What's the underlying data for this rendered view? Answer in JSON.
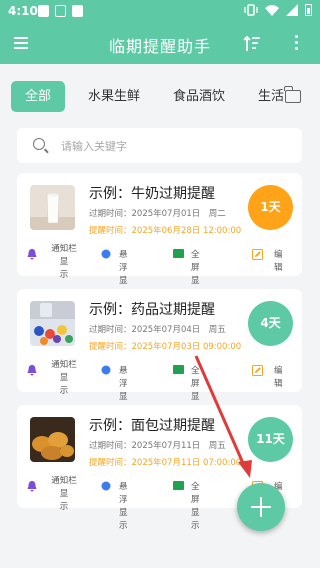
{
  "status": {
    "time": "4:10"
  },
  "appbar": {
    "title": "临期提醒助手"
  },
  "tabs": [
    "全部",
    "水果生鲜",
    "食品酒饮",
    "生活"
  ],
  "search": {
    "placeholder": "请输入关键字",
    "value": ""
  },
  "actions": {
    "notify": "通知栏显\n示",
    "float": "悬浮显示",
    "fullscreen": "全屏显示",
    "edit": "编辑"
  },
  "items": [
    {
      "title": "示例：牛奶过期提醒",
      "expire": "过期时间：2025年07月01日　周二",
      "remind": "提醒时间：2025年06月28日 12:00:00",
      "badge": "1天",
      "badge_color": "#ffa319",
      "image": "milk-photo"
    },
    {
      "title": "示例：药品过期提醒",
      "expire": "过期时间：2025年07月04日　周五",
      "remind": "提醒时间：2025年07月03日 09:00:00",
      "badge": "4天",
      "badge_color": "#5dcaa5",
      "image": "medicine-photo"
    },
    {
      "title": "示例：面包过期提醒",
      "expire": "过期时间：2025年07月11日　周五",
      "remind": "提醒时间：2025年07月11日 07:00:00",
      "badge": "11天",
      "badge_color": "#5dcaa5",
      "image": "bread-photo"
    }
  ],
  "colors": {
    "primary": "#5dcaa5",
    "warning": "#ffa319",
    "remind_text": "#f5a524",
    "bell": "#7b4ddb",
    "float_dot": "#3b7cf0",
    "fullscreen": "#20a050",
    "edit": "#f5a524"
  }
}
